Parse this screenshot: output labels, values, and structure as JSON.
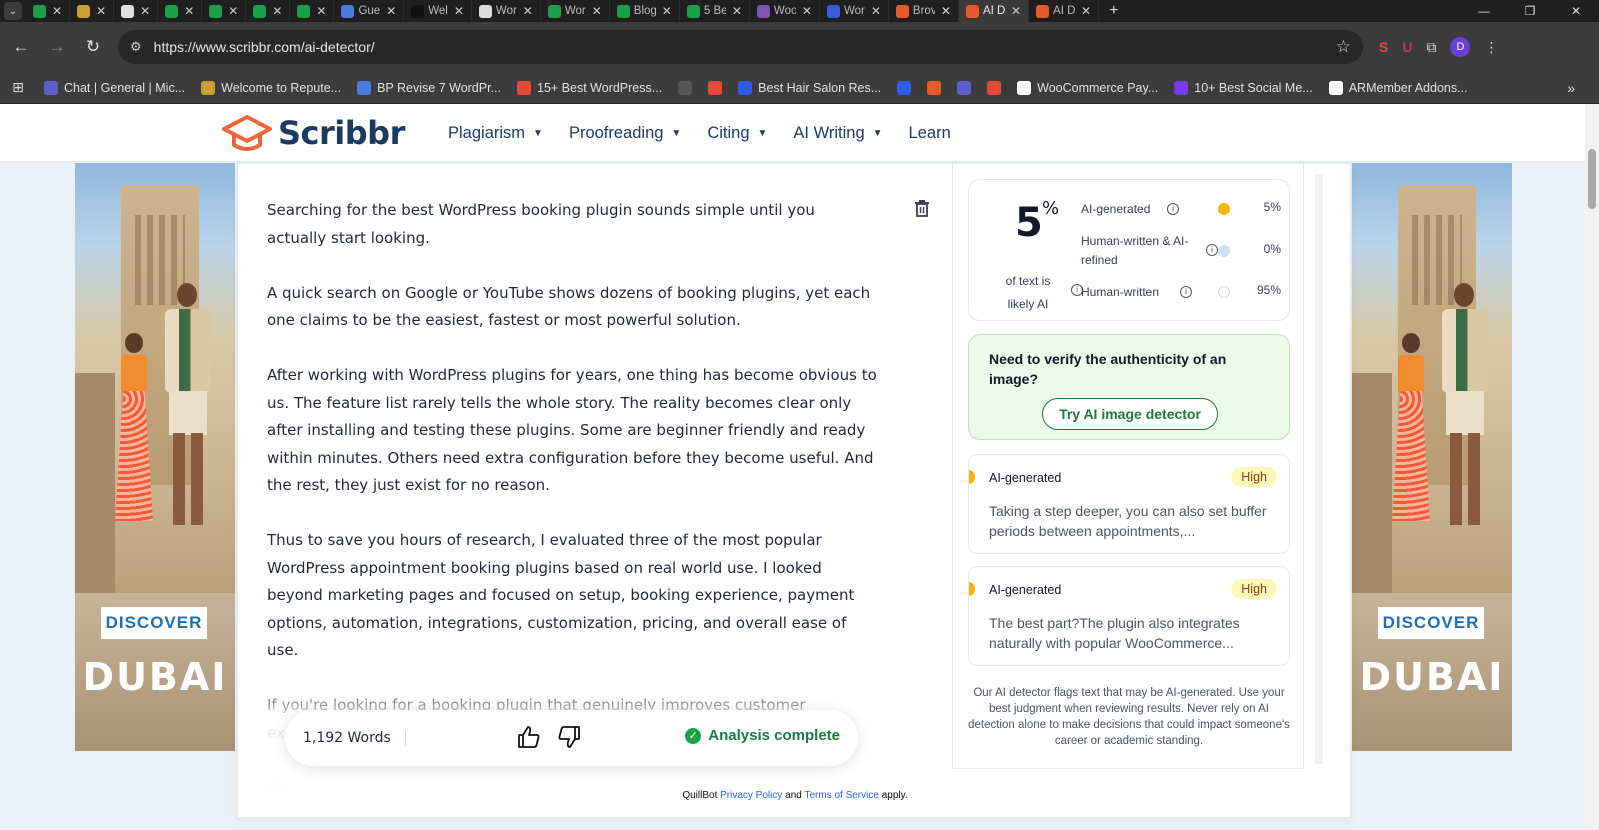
{
  "browser": {
    "tabs": [
      {
        "title": "",
        "color": "#1aa24a"
      },
      {
        "title": "",
        "color": "#c8a030"
      },
      {
        "title": "",
        "color": "#e0e0e0"
      },
      {
        "title": "",
        "color": "#1aa24a"
      },
      {
        "title": "",
        "color": "#1aa24a"
      },
      {
        "title": "",
        "color": "#1aa24a"
      },
      {
        "title": "",
        "color": "#1aa24a"
      },
      {
        "title": "Gue",
        "color": "#4a7be0"
      },
      {
        "title": "Wel",
        "color": "#111111"
      },
      {
        "title": "Wor",
        "color": "#dddddd"
      },
      {
        "title": "Wor",
        "color": "#1aa24a"
      },
      {
        "title": "Blog",
        "color": "#1aa24a"
      },
      {
        "title": "5 Be",
        "color": "#1aa24a"
      },
      {
        "title": "Woo",
        "color": "#7f54b3"
      },
      {
        "title": "Wor",
        "color": "#3b5bdb"
      },
      {
        "title": "Brov",
        "color": "#e85a2a"
      },
      {
        "title": "AI D",
        "color": "#e85a2a",
        "active": true
      },
      {
        "title": "AI D",
        "color": "#e85a2a"
      }
    ],
    "url": "https://www.scribbr.com/ai-detector/",
    "profile_initial": "D",
    "bookmarks": [
      {
        "label": "Chat | General | Mic...",
        "color": "#5b5fc7"
      },
      {
        "label": "Welcome to Repute...",
        "color": "#c8a030"
      },
      {
        "label": "BP Revise 7 WordPr...",
        "color": "#4a7be0"
      },
      {
        "label": "15+ Best WordPress...",
        "color": "#e84a3a"
      },
      {
        "label": "",
        "color": "#555555"
      },
      {
        "label": "",
        "color": "#e84a3a"
      },
      {
        "label": "Best Hair Salon Res...",
        "color": "#2f5bea"
      },
      {
        "label": "",
        "color": "#2f5bea"
      },
      {
        "label": "",
        "color": "#e85a2a"
      },
      {
        "label": "",
        "color": "#5b5fc7"
      },
      {
        "label": "",
        "color": "#e84a3a"
      },
      {
        "label": "WooCommerce Pay...",
        "color": "#ffffff"
      },
      {
        "label": "10+ Best Social Me...",
        "color": "#7c3aed"
      },
      {
        "label": "ARMember Addons...",
        "color": "#ffffff"
      }
    ]
  },
  "site": {
    "logo_text": "Scribbr",
    "nav": [
      {
        "label": "Plagiarism",
        "has_menu": true
      },
      {
        "label": "Proofreading",
        "has_menu": true
      },
      {
        "label": "Citing",
        "has_menu": true
      },
      {
        "label": "AI Writing",
        "has_menu": true
      },
      {
        "label": "Learn",
        "has_menu": false
      }
    ]
  },
  "ads": {
    "cta": "DISCOVER",
    "brand": "DUBAI"
  },
  "editor": {
    "paragraphs": [
      "Searching for the best WordPress booking plugin sounds simple until you actually start looking.",
      "A quick search on Google or YouTube shows dozens of booking plugins, yet each one claims to be the easiest, fastest or most powerful solution.",
      "After working with WordPress plugins for years, one thing has become obvious to us. The feature list rarely tells the whole story. The reality becomes clear only after installing and testing these plugins. Some are beginner friendly and ready within minutes. Others need extra configuration before they become useful. And the rest, they just exist for no reason.",
      "Thus to save you hours of research, I evaluated three of the most popular WordPress appointment booking plugins based on real world use.  I looked beyond marketing pages and focused on setup, booking experience, payment options, automation, integrations, customization, pricing, and overall ease of use.",
      "If you're looking for a booking plugin that genuinely improves customer experience and appointment management, here get going.",
      "Qu"
    ],
    "word_count": "1,192 Words",
    "status": "Analysis complete"
  },
  "results": {
    "score": "5",
    "score_unit": "%",
    "score_caption": "of text is likely AI",
    "rows": [
      {
        "label": "AI-generated",
        "pct": "5%",
        "color": "#f5b50a"
      },
      {
        "label": "Human-written & AI-refined",
        "pct": "0%",
        "color": "#cfe0f5"
      },
      {
        "label": "Human-written",
        "pct": "95%",
        "color": "#ffffff"
      }
    ],
    "promo_text": "Need to verify the authenticity of an image?",
    "promo_button": "Try AI image detector",
    "items": [
      {
        "type": "AI-generated",
        "level": "High",
        "snippet": "Taking a step deeper, you can also set buffer periods between appointments,..."
      },
      {
        "type": "AI-generated",
        "level": "High",
        "snippet": "The best part?The plugin also integrates naturally with popular WooCommerce..."
      }
    ],
    "disclaimer": "Our AI detector flags text that may be AI-generated. Use your best judgment when reviewing results. Never rely on AI detection alone to make decisions that could impact someone's career or academic standing."
  },
  "footer": {
    "prefix": "QuillBot",
    "privacy": "Privacy Policy",
    "and": "and",
    "terms": "Terms of Service",
    "suffix": "apply."
  }
}
